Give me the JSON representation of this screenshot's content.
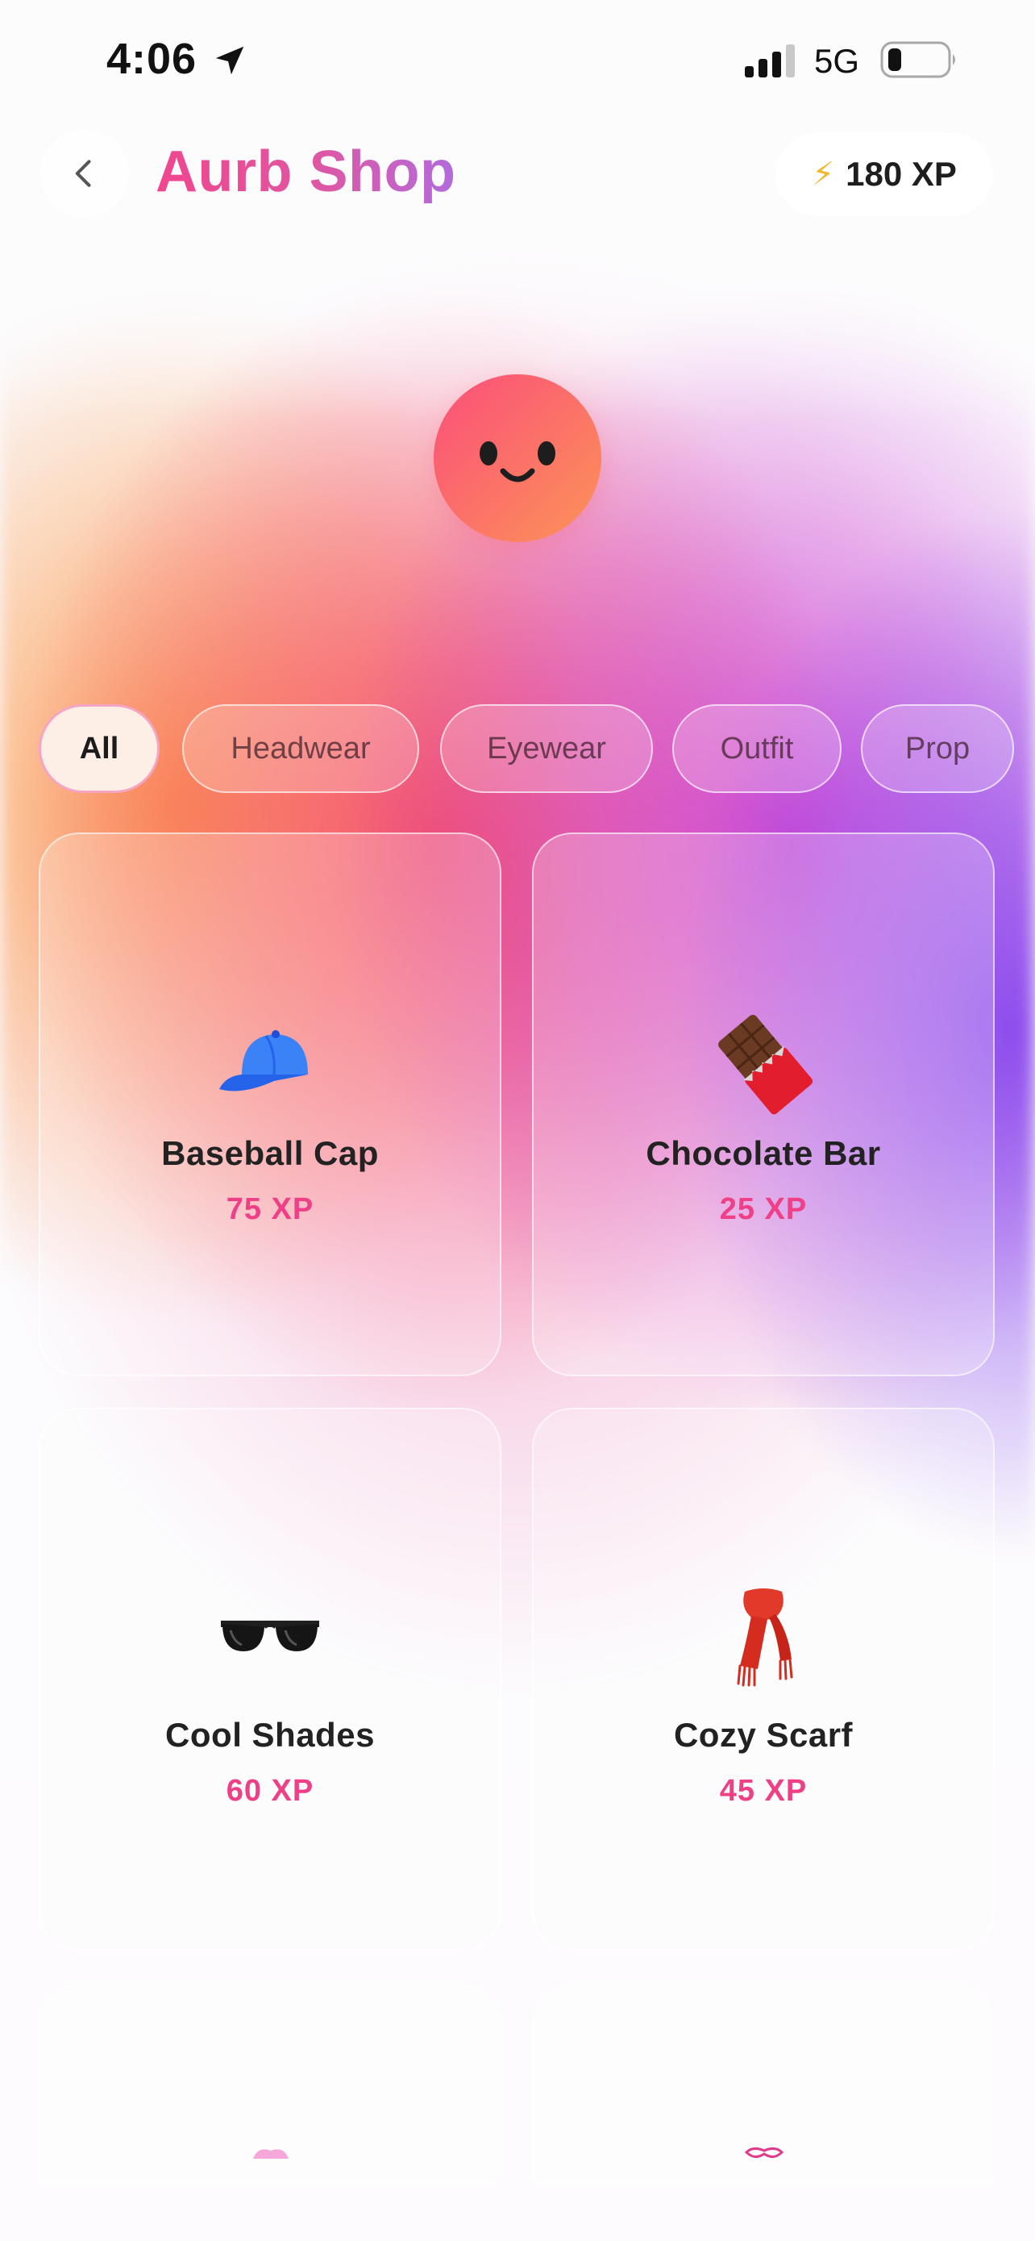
{
  "status_bar": {
    "time": "4:06",
    "network": "5G"
  },
  "header": {
    "title": "Aurb Shop",
    "xp_balance": "180 XP",
    "back_icon": "chevron-left-icon",
    "xp_icon": "lightning-bolt-icon"
  },
  "avatar": {
    "icon": "smiley-face-icon"
  },
  "filters": [
    {
      "label": "All",
      "active": true
    },
    {
      "label": "Headwear",
      "active": false
    },
    {
      "label": "Eyewear",
      "active": false
    },
    {
      "label": "Outfit",
      "active": false
    },
    {
      "label": "Prop",
      "active": false
    }
  ],
  "items": [
    {
      "name": "Baseball Cap",
      "price": "75 XP",
      "icon": "baseball-cap-icon"
    },
    {
      "name": "Chocolate Bar",
      "price": "25 XP",
      "icon": "chocolate-bar-icon"
    },
    {
      "name": "Cool Shades",
      "price": "60 XP",
      "icon": "sunglasses-icon"
    },
    {
      "name": "Cozy Scarf",
      "price": "45 XP",
      "icon": "scarf-icon"
    }
  ],
  "colors": {
    "accent_pink": "#ef3f86",
    "title_gradient_start": "#f0468f",
    "title_gradient_end": "#b26bdc",
    "xp_bolt": "#f5b731",
    "avatar_start": "#fb4f7a",
    "avatar_end": "#fd9458"
  }
}
